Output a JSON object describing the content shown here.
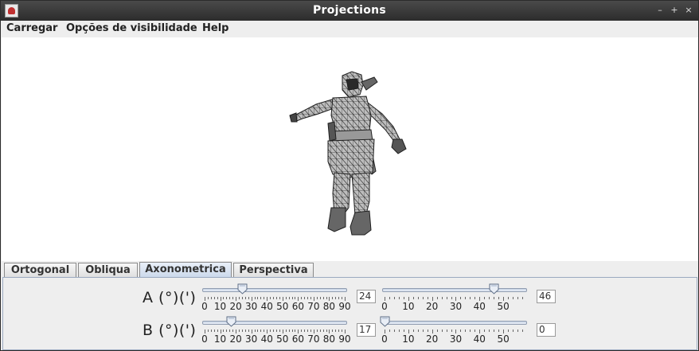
{
  "window": {
    "title": "Projections"
  },
  "menu": {
    "items": [
      "Carregar",
      "Opções de visibilidade",
      "Help"
    ]
  },
  "tabs": {
    "items": [
      "Ortogonal",
      "Obliqua",
      "Axonometrica",
      "Perspectiva"
    ],
    "active": "Axonometrica"
  },
  "panel": {
    "rows": [
      {
        "label": "A (°)(')",
        "degrees": {
          "value": "24",
          "level": 24,
          "min": 0,
          "max": 90,
          "ticks": [
            "0",
            "10",
            "20",
            "30",
            "40",
            "50",
            "60",
            "70",
            "80",
            "90"
          ]
        },
        "minutes": {
          "value": "46",
          "level": 46,
          "min": 0,
          "max": 59,
          "ticks": [
            "0",
            "10",
            "20",
            "30",
            "40",
            "50"
          ]
        }
      },
      {
        "label": "B (°)(')",
        "degrees": {
          "value": "17",
          "level": 17,
          "min": 0,
          "max": 90,
          "ticks": [
            "0",
            "10",
            "20",
            "30",
            "40",
            "50",
            "60",
            "70",
            "80",
            "90"
          ]
        },
        "minutes": {
          "value": "0",
          "level": 0,
          "min": 0,
          "max": 59,
          "ticks": [
            "0",
            "10",
            "20",
            "30",
            "40",
            "50"
          ]
        }
      }
    ]
  },
  "canvas": {
    "figure": "3d-wireframe-character-model"
  },
  "window_controls": {
    "minimize": "–",
    "maximize": "+",
    "close": "×"
  },
  "colors": {
    "titlebar": "#2c2c2c",
    "active_tab": "#c9d7ea",
    "slider_track": "#c9d5e6"
  }
}
